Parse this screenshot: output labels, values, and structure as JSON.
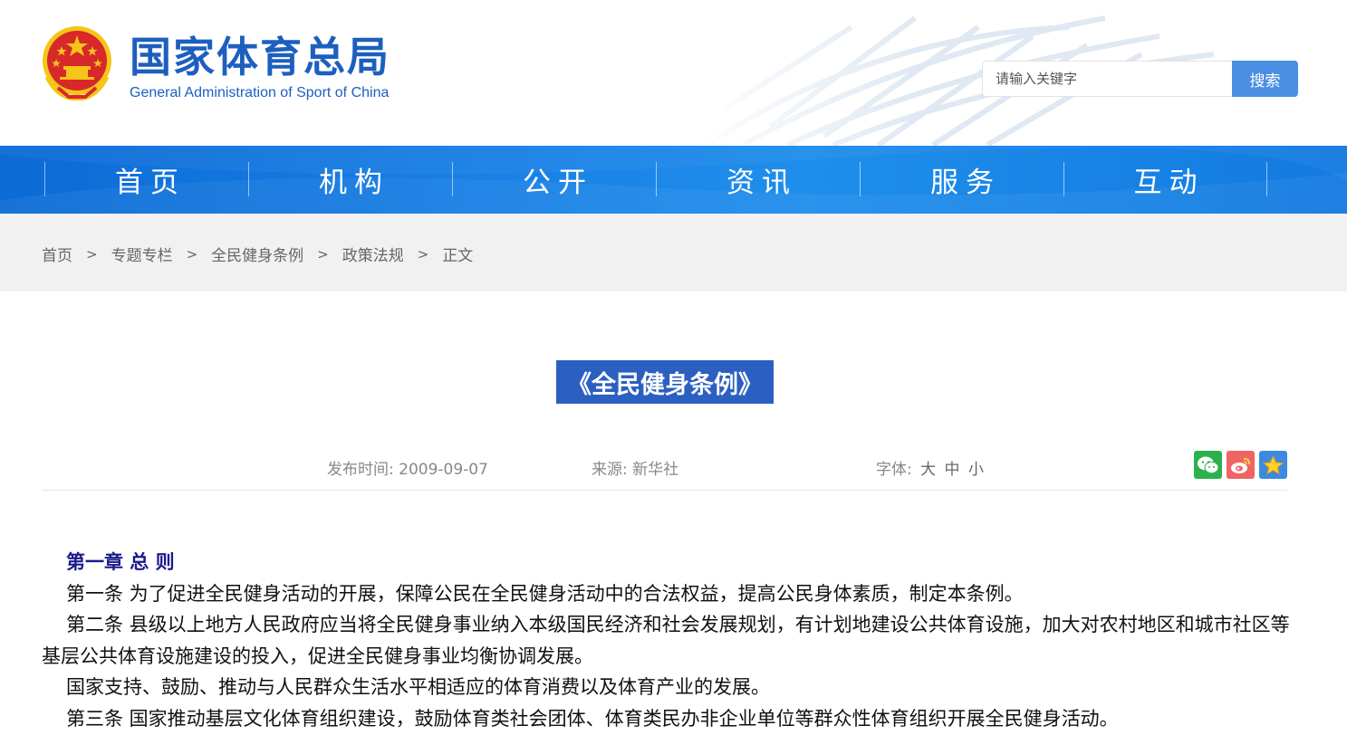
{
  "header": {
    "logo_cn": "国家体育总局",
    "logo_en": "General Administration of Sport of China",
    "search_placeholder": "请输入关键字",
    "search_button": "搜索"
  },
  "nav": {
    "items": [
      {
        "label": "首页"
      },
      {
        "label": "机构"
      },
      {
        "label": "公开"
      },
      {
        "label": "资讯"
      },
      {
        "label": "服务"
      },
      {
        "label": "互动"
      }
    ]
  },
  "breadcrumb": {
    "items": [
      "首页",
      "专题专栏",
      "全民健身条例",
      "政策法规",
      "正文"
    ],
    "separator": ">"
  },
  "article": {
    "title": "《全民健身条例》",
    "publish_label": "发布时间:",
    "publish_date": "2009-09-07",
    "source_label": "来源:",
    "source": "新华社",
    "font_label": "字体:",
    "font_large": "大",
    "font_medium": "中",
    "font_small": "小",
    "share_icons": [
      "wechat-icon",
      "weibo-icon",
      "favorite-icon"
    ],
    "chapter": "第一章 总 则",
    "paragraphs": [
      "第一条 为了促进全民健身活动的开展，保障公民在全民健身活动中的合法权益，提高公民身体素质，制定本条例。",
      "第二条 县级以上地方人民政府应当将全民健身事业纳入本级国民经济和社会发展规划，有计划地建设公共体育设施，加大对农村地区和城市社区等基层公共体育设施建设的投入，促进全民健身事业均衡协调发展。",
      "国家支持、鼓励、推动与人民群众生活水平相适应的体育消费以及体育产业的发展。",
      "第三条 国家推动基层文化体育组织建设，鼓励体育类社会团体、体育类民办非企业单位等群众性体育组织开展全民健身活动。"
    ]
  },
  "colors": {
    "brand_blue": "#1d5fbf",
    "nav_blue": "#1a82e6",
    "title_bg": "#2b5fc1",
    "search_btn": "#4a8fe2",
    "chapter_color": "#1a1a8c",
    "emblem_red": "#d7282a",
    "emblem_gold": "#f5c518"
  }
}
